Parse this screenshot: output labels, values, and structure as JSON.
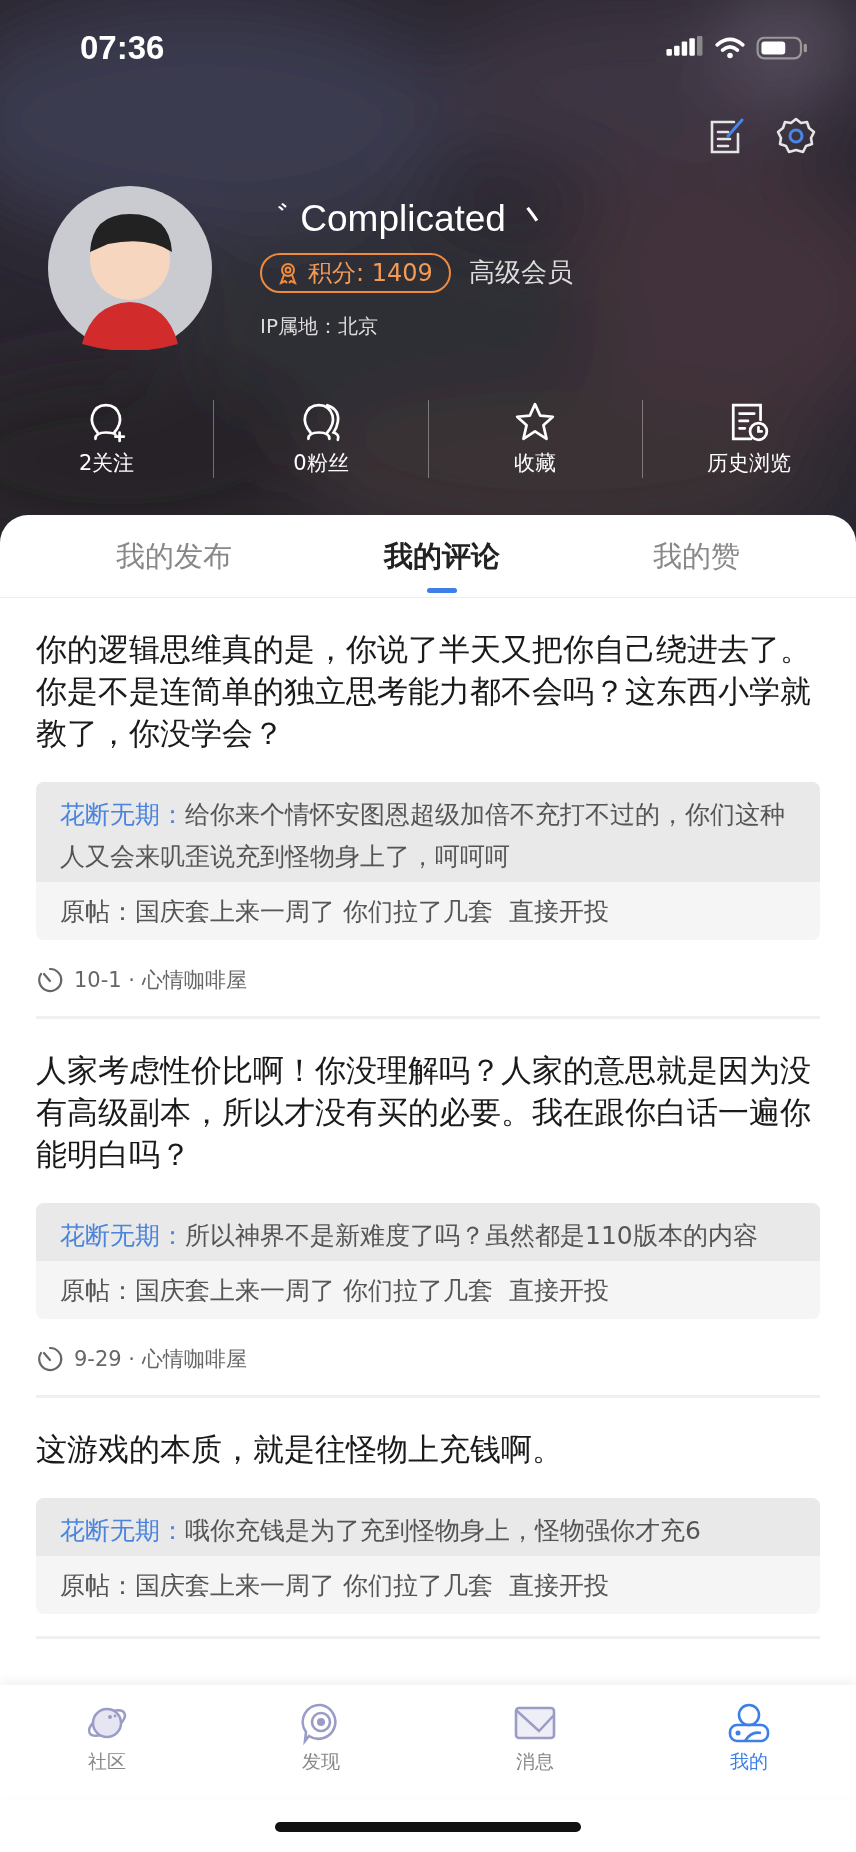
{
  "status_bar": {
    "time": "07:36"
  },
  "profile": {
    "name": "゛ Complicated 丶",
    "points": "积分: 1409",
    "member_level": "高级会员",
    "ip_location": "IP属地：北京"
  },
  "stats": [
    {
      "label": "2关注"
    },
    {
      "label": "0粉丝"
    },
    {
      "label": "收藏"
    },
    {
      "label": "历史浏览"
    }
  ],
  "tabs": [
    {
      "label": "我的发布",
      "selected": false
    },
    {
      "label": "我的评论",
      "selected": true
    },
    {
      "label": "我的赞",
      "selected": false
    }
  ],
  "comments": [
    {
      "text": "你的逻辑思维真的是，你说了半天又把你自己绕进去了。你是不是连简单的独立思考能力都不会吗？这东西小学就教了，你没学会？",
      "reply_author": "花断无期：",
      "reply_text": "给你来个情怀安图恩超级加倍不充打不过的，你们这种人又会来叽歪说充到怪物身上了，呵呵呵",
      "original_post": "原帖：国庆套上来一周了 你们拉了几套  直接开投",
      "meta": "10-1 · 心情咖啡屋"
    },
    {
      "text": "人家考虑性价比啊！你没理解吗？人家的意思就是因为没有高级副本，所以才没有买的必要。我在跟你白话一遍你能明白吗？",
      "reply_author": "花断无期：",
      "reply_text": "所以神界不是新难度了吗？虽然都是110版本的内容",
      "original_post": "原帖：国庆套上来一周了 你们拉了几套  直接开投",
      "meta": "9-29 · 心情咖啡屋"
    },
    {
      "text": "这游戏的本质，就是往怪物上充钱啊。",
      "reply_author": "花断无期：",
      "reply_text": "哦你充钱是为了充到怪物身上，怪物强你才充6",
      "original_post": "原帖：国庆套上来一周了 你们拉了几套  直接开投"
    }
  ],
  "bottom_nav": [
    {
      "label": "社区",
      "selected": false
    },
    {
      "label": "发现",
      "selected": false
    },
    {
      "label": "消息",
      "selected": false
    },
    {
      "label": "我的",
      "selected": true
    }
  ]
}
